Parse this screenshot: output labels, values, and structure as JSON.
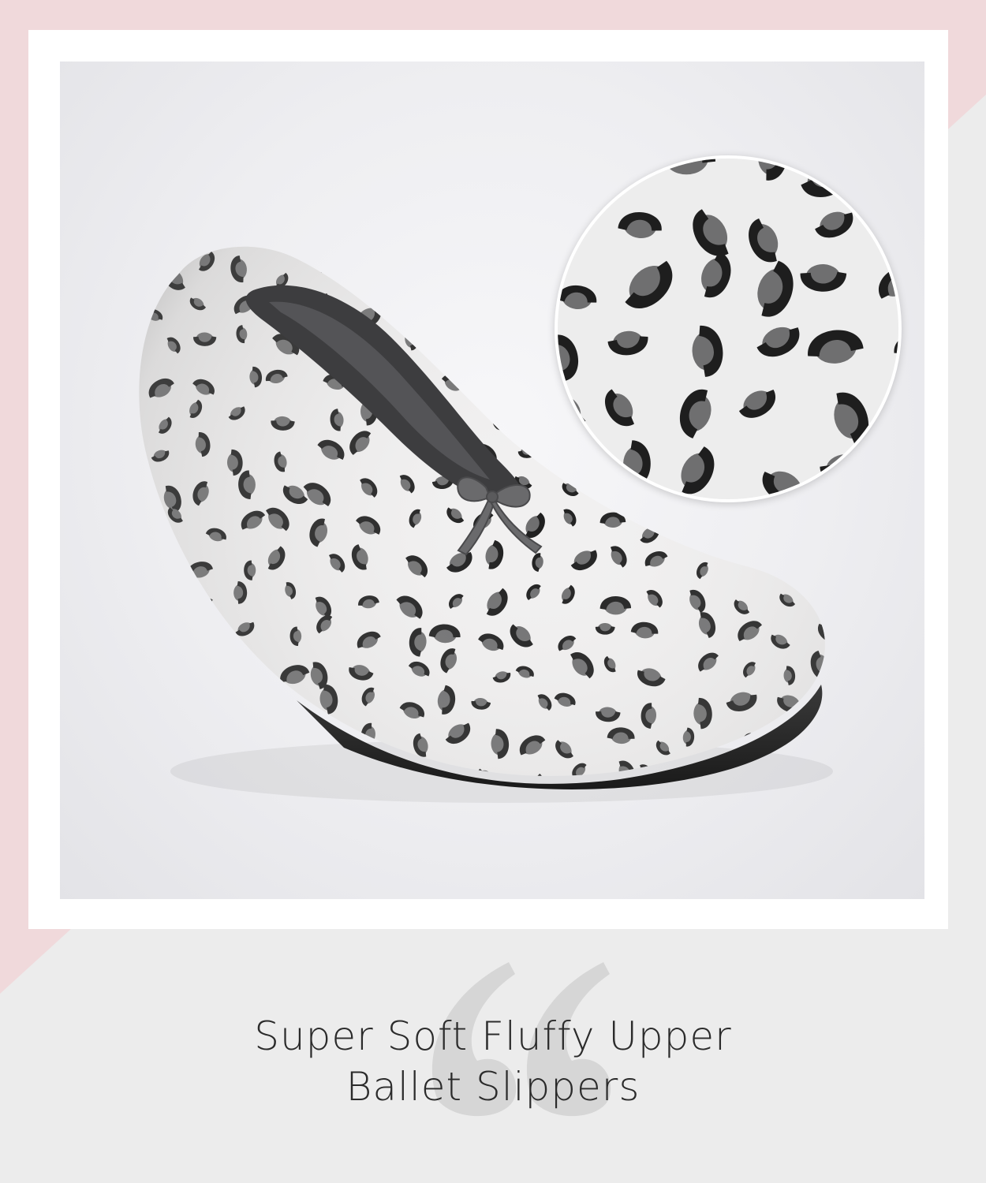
{
  "caption": {
    "line1": "Super Soft Fluffy Upper",
    "line2": "Ballet Slippers"
  },
  "colors": {
    "pink_accent": "#f0d9db",
    "background": "#ececec",
    "frame": "#ffffff",
    "caption_text": "#2b2b2b",
    "quote_mark": "#d6d6d6",
    "spot_dark": "#1e1e1e",
    "spot_mid": "#6f6f70",
    "slipper_base": "#f1f0f0"
  },
  "product": {
    "pattern": "snow leopard print",
    "accent": "grey velvet bow"
  }
}
